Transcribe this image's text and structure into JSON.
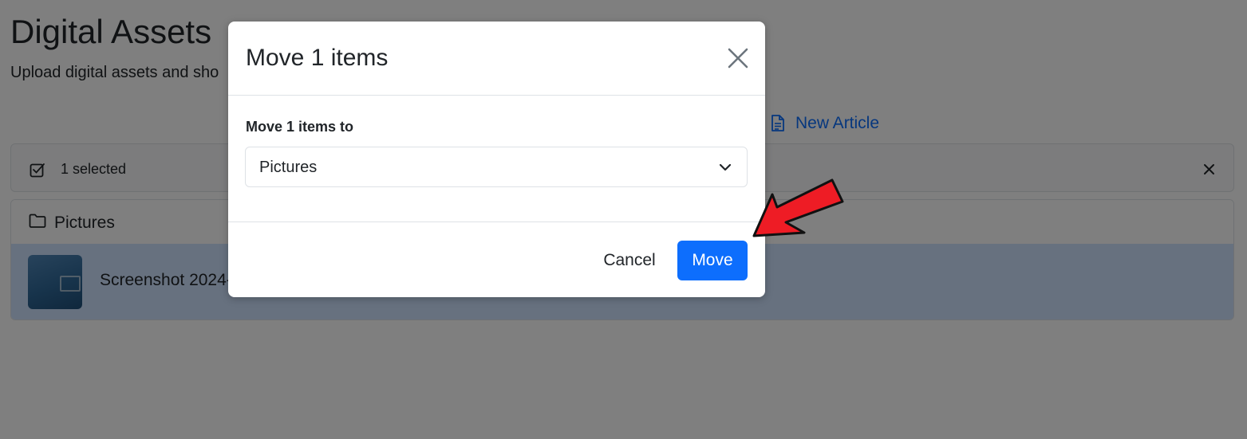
{
  "page": {
    "title": "Digital Assets",
    "subtitle": "Upload digital assets and sho",
    "new_article_label": "New Article"
  },
  "selection_bar": {
    "text": "1 selected"
  },
  "asset_list": {
    "folder_name": "Pictures",
    "file_name": "Screenshot 2024-"
  },
  "modal": {
    "title": "Move 1 items",
    "field_label": "Move 1 items to",
    "selected_folder": "Pictures",
    "cancel_label": "Cancel",
    "move_label": "Move"
  },
  "colors": {
    "accent": "#0d6efd",
    "selected_row": "#cfe2ff",
    "annotation_arrow": "#ee1c25"
  },
  "icons": [
    "file-text-icon",
    "check-square-icon",
    "close-icon",
    "folder-icon",
    "chevron-down-icon",
    "arrow-annotation"
  ]
}
